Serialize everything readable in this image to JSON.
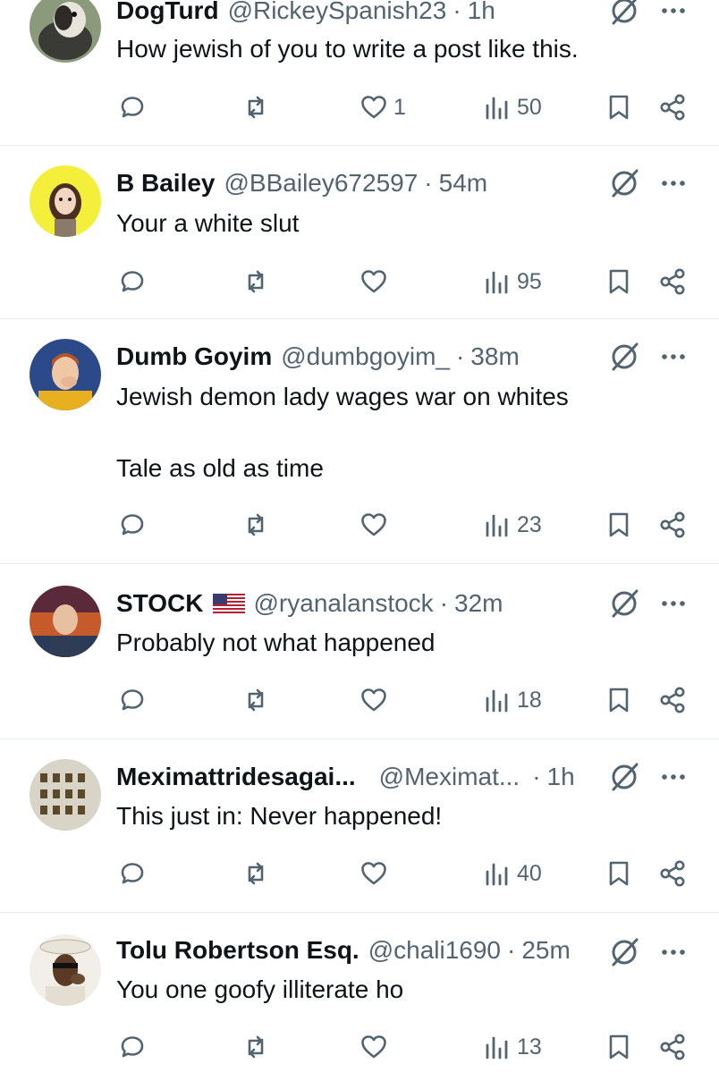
{
  "colors": {
    "text": "#0f1419",
    "secondary": "#536471",
    "divider": "#e6ecf0"
  },
  "icons": {
    "reply": "reply-bubble-icon",
    "repost": "repost-icon",
    "like": "heart-icon",
    "views": "views-bar-icon",
    "bookmark": "bookmark-icon",
    "share": "share-icon",
    "grok": "grok-icon",
    "more": "more-dots-icon"
  },
  "posts": [
    {
      "name": "DogTurd",
      "handle": "@RickeySpanish23",
      "time": "1h",
      "lines": [
        "How jewish of you to write a post like this."
      ],
      "likes": "1",
      "views": "50"
    },
    {
      "name": "B Bailey",
      "handle": "@BBailey672597",
      "time": "54m",
      "lines": [
        "Your a white slut"
      ],
      "likes": "",
      "views": "95"
    },
    {
      "name": "Dumb Goyim",
      "handle": "@dumbgoyim_",
      "time": "38m",
      "lines": [
        "Jewish demon lady wages war on whites",
        "Tale as old as time"
      ],
      "likes": "",
      "views": "23"
    },
    {
      "name": "STOCK",
      "handle": "@ryanalanstock",
      "time": "32m",
      "lines": [
        "Probably not what happened"
      ],
      "likes": "",
      "views": "18"
    },
    {
      "name": "Meximattridesagai...",
      "handle": "@Meximat...",
      "time": "1h",
      "lines": [
        "This just in: Never happened!"
      ],
      "likes": "",
      "views": "40"
    },
    {
      "name": "Tolu Robertson Esq.",
      "handle": "@chali1690",
      "time": "25m",
      "lines": [
        "You one goofy illiterate ho"
      ],
      "likes": "",
      "views": "13"
    }
  ]
}
